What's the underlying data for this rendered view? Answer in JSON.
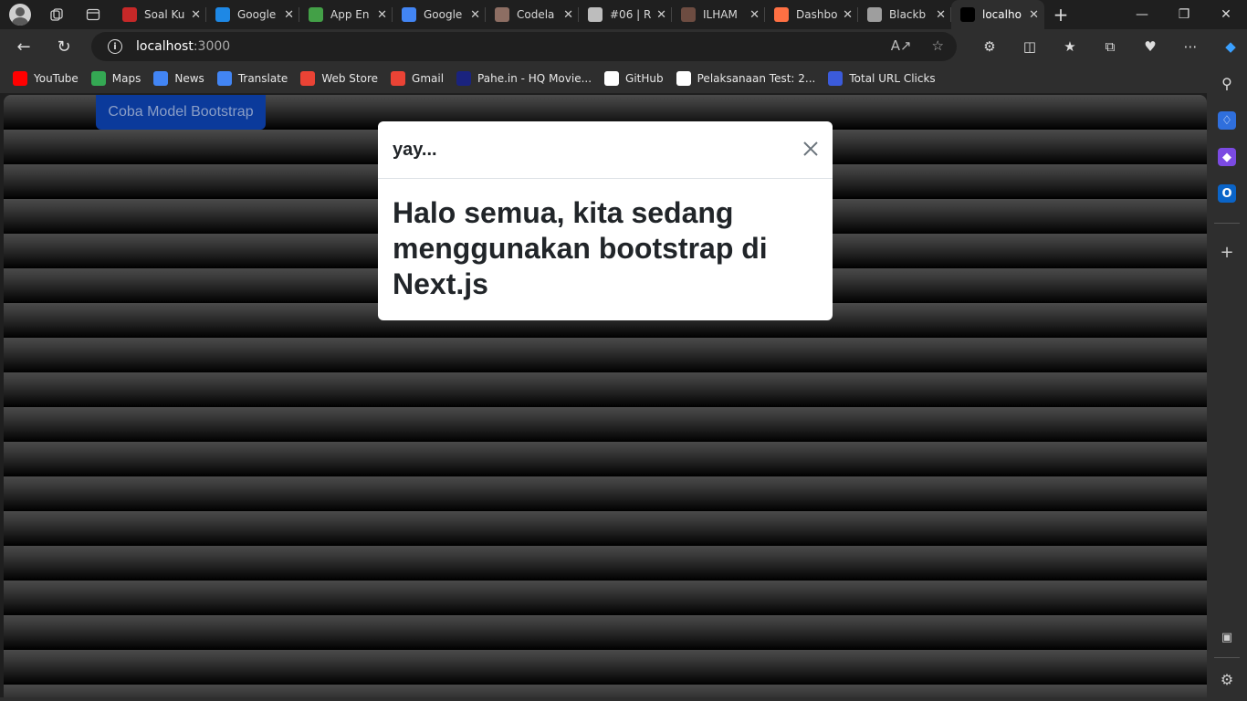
{
  "browser": {
    "tabs": [
      {
        "title": "Soal Ku",
        "favicon_color": "#c62828",
        "favicon_icon": "pdf-icon"
      },
      {
        "title": "Google",
        "favicon_color": "#1e88e5",
        "favicon_icon": "drive-icon"
      },
      {
        "title": "App En",
        "favicon_color": "#43a047",
        "favicon_icon": "drive-icon"
      },
      {
        "title": "Google",
        "favicon_color": "#4285f4",
        "favicon_icon": "search-icon"
      },
      {
        "title": "Codela",
        "favicon_color": "#8d6e63",
        "favicon_icon": "codelab-icon"
      },
      {
        "title": "#06 | R",
        "favicon_color": "#bdbdbd",
        "favicon_icon": "document-icon"
      },
      {
        "title": "ILHAM",
        "favicon_color": "#6d4c41",
        "favicon_icon": "seal-icon"
      },
      {
        "title": "Dashbo",
        "favicon_color": "#ff7043",
        "favicon_icon": "dashboard-icon"
      },
      {
        "title": "Blackb",
        "favicon_color": "#9e9e9e",
        "favicon_icon": "image-icon"
      },
      {
        "title": "localho",
        "favicon_color": "#000000",
        "favicon_icon": "nextjs-icon",
        "active": true
      }
    ],
    "url_host": "localhost",
    "url_port": ":3000",
    "bookmarks": [
      {
        "label": "YouTube",
        "color": "#ff0000"
      },
      {
        "label": "Maps",
        "color": "#34a853"
      },
      {
        "label": "News",
        "color": "#4285f4"
      },
      {
        "label": "Translate",
        "color": "#4285f4"
      },
      {
        "label": "Web Store",
        "color": "#ea4335"
      },
      {
        "label": "Gmail",
        "color": "#ea4335"
      },
      {
        "label": "Pahe.in - HQ Movie...",
        "color": "#1a237e"
      },
      {
        "label": "GitHub",
        "color": "#ffffff"
      },
      {
        "label": "Pelaksanaan Test: 2...",
        "color": "#ffffff"
      },
      {
        "label": "Total URL Clicks",
        "color": "#3b5bdb"
      }
    ]
  },
  "page": {
    "open_button_label": "Coba Model Bootstrap",
    "open_button_color": "#0b3a9b"
  },
  "modal": {
    "title": "yay...",
    "body": "Halo semua, kita sedang menggunakan bootstrap di Next.js"
  }
}
